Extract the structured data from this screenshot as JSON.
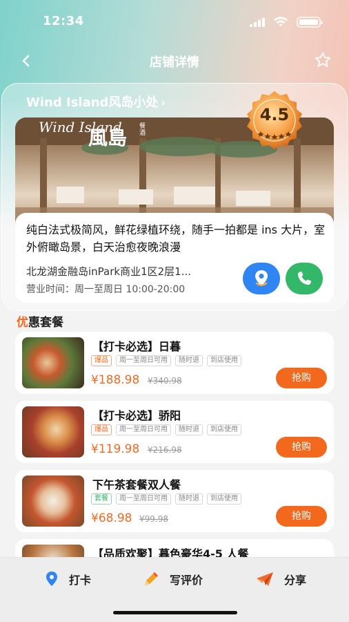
{
  "status_bar": {
    "time": "12:34"
  },
  "nav": {
    "title": "店铺详情",
    "back_icon": "chevron-left-icon",
    "favorite_icon": "star-icon"
  },
  "store": {
    "name": "Wind Island风岛小处",
    "name_chevron": "›",
    "rating": "4.5",
    "photo_logo_en": "Wind Island",
    "photo_logo_cn": "風島",
    "photo_logo_sub": "餐酒",
    "description": "纯白法式极简风，鲜花绿植环绕，随手一拍都是 ins 大片，室外俯瞰岛景，白天治愈夜晚浪漫",
    "address": "北龙湖金融岛inPark商业1区2层1...",
    "hours": "营业时间：周一至周日 10:00-20:00"
  },
  "section": {
    "first_char": "优",
    "rest": "惠套餐"
  },
  "deals": [
    {
      "title": "【打卡必选】日暮",
      "tags": [
        "爆品",
        "周一至周日可用",
        "随时退",
        "到店使用"
      ],
      "price": "¥188.98",
      "orig_price": "¥340.98",
      "buy": "抢购"
    },
    {
      "title": "【打卡必选】骄阳",
      "tags": [
        "爆品",
        "周一至周日可用",
        "随时退",
        "到店使用"
      ],
      "price": "¥119.98",
      "orig_price": "¥216.98",
      "buy": "抢购"
    },
    {
      "title": "下午茶套餐双人餐",
      "tags": [
        "套餐",
        "周一至周日可用",
        "随时退",
        "到店使用"
      ],
      "price": "¥68.98",
      "orig_price": "¥99.98",
      "buy": "抢购"
    },
    {
      "title": "【品质欢聚】暮色豪华4-5 人餐"
    }
  ],
  "bottom_bar": {
    "checkin": "打卡",
    "review": "写评价",
    "share": "分享"
  },
  "colors": {
    "accent": "#f2691d",
    "nav_blue": "#2f86f2",
    "call_green": "#33b86a"
  }
}
